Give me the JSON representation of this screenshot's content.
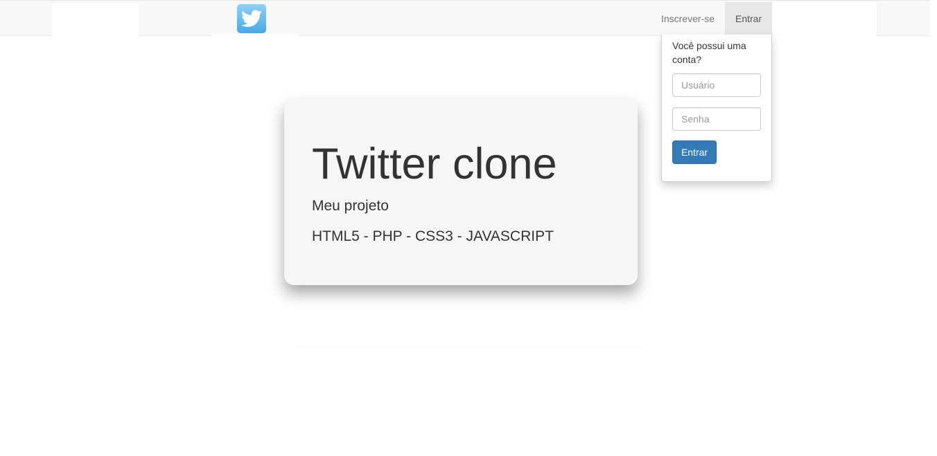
{
  "navbar": {
    "logo_icon": "twitter-bird-icon",
    "signup_label": "Inscrever-se",
    "login_label": "Entrar"
  },
  "login_dropdown": {
    "title": "Você possui uma conta?",
    "username_placeholder": "Usuário",
    "password_placeholder": "Senha",
    "submit_label": "Entrar"
  },
  "jumbotron": {
    "title": "Twitter clone",
    "subtitle": "Meu projeto",
    "tech": "HTML5 - PHP - CSS3 - JAVASCRIPT"
  },
  "colors": {
    "navbar_bg": "#f8f8f8",
    "primary": "#337ab7",
    "twitter_blue": "#55acee"
  }
}
